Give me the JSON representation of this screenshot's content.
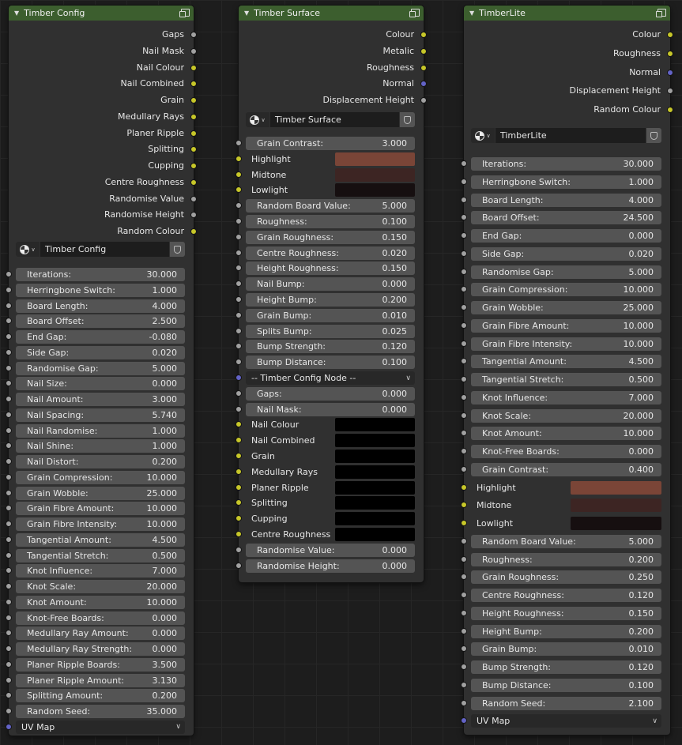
{
  "nodes": [
    {
      "id": "timber-config",
      "title": "Timber Config",
      "outputs": [
        {
          "label": "Gaps",
          "socket": "gray"
        },
        {
          "label": "Nail Mask",
          "socket": "gray"
        },
        {
          "label": "Nail Colour",
          "socket": "yellow"
        },
        {
          "label": "Nail Combined",
          "socket": "yellow"
        },
        {
          "label": "Grain",
          "socket": "yellow"
        },
        {
          "label": "Medullary Rays",
          "socket": "yellow"
        },
        {
          "label": "Planer Ripple",
          "socket": "yellow"
        },
        {
          "label": "Splitting",
          "socket": "yellow"
        },
        {
          "label": "Cupping",
          "socket": "yellow"
        },
        {
          "label": "Centre Roughness",
          "socket": "yellow"
        },
        {
          "label": "Randomise Value",
          "socket": "gray"
        },
        {
          "label": "Randomise Height",
          "socket": "gray"
        },
        {
          "label": "Random Colour",
          "socket": "yellow"
        }
      ],
      "group_name": "Timber Config",
      "inputs": [
        {
          "kind": "field",
          "label": "Iterations:",
          "value": "30.000"
        },
        {
          "kind": "field",
          "label": "Herringbone Switch:",
          "value": "1.000"
        },
        {
          "kind": "field",
          "label": "Board Length:",
          "value": "4.000"
        },
        {
          "kind": "field",
          "label": "Board Offset:",
          "value": "2.500"
        },
        {
          "kind": "field",
          "label": "End Gap:",
          "value": "-0.080"
        },
        {
          "kind": "field",
          "label": "Side Gap:",
          "value": "0.020"
        },
        {
          "kind": "field",
          "label": "Randomise Gap:",
          "value": "5.000"
        },
        {
          "kind": "field",
          "label": "Nail Size:",
          "value": "0.000"
        },
        {
          "kind": "field",
          "label": "Nail Amount:",
          "value": "3.000"
        },
        {
          "kind": "field",
          "label": "Nail Spacing:",
          "value": "5.740"
        },
        {
          "kind": "field",
          "label": "Nail Randomise:",
          "value": "1.000"
        },
        {
          "kind": "field",
          "label": "Nail Shine:",
          "value": "1.000"
        },
        {
          "kind": "field",
          "label": "Nail Distort:",
          "value": "0.200"
        },
        {
          "kind": "field",
          "label": "Grain Compression:",
          "value": "10.000"
        },
        {
          "kind": "field",
          "label": "Grain Wobble:",
          "value": "25.000"
        },
        {
          "kind": "field",
          "label": "Grain Fibre Amount:",
          "value": "10.000"
        },
        {
          "kind": "field",
          "label": "Grain Fibre Intensity:",
          "value": "10.000"
        },
        {
          "kind": "field",
          "label": "Tangential Amount:",
          "value": "4.500"
        },
        {
          "kind": "field",
          "label": "Tangential Stretch:",
          "value": "0.500"
        },
        {
          "kind": "field",
          "label": "Knot Influence:",
          "value": "7.000"
        },
        {
          "kind": "field",
          "label": "Knot Scale:",
          "value": "20.000"
        },
        {
          "kind": "field",
          "label": "Knot Amount:",
          "value": "10.000"
        },
        {
          "kind": "field",
          "label": "Knot-Free Boards:",
          "value": "0.000"
        },
        {
          "kind": "field",
          "label": "Medullary Ray Amount:",
          "value": "0.000"
        },
        {
          "kind": "field",
          "label": "Medullary Ray Strength:",
          "value": "0.000"
        },
        {
          "kind": "field",
          "label": "Planer Ripple Boards:",
          "value": "3.500"
        },
        {
          "kind": "field",
          "label": "Planer Ripple Amount:",
          "value": "3.130"
        },
        {
          "kind": "field",
          "label": "Splitting Amount:",
          "value": "0.200"
        },
        {
          "kind": "field",
          "label": "Random Seed:",
          "value": "35.000"
        },
        {
          "kind": "dropdown",
          "label": "UV Map",
          "socket": "blue"
        }
      ]
    },
    {
      "id": "timber-surface",
      "title": "Timber Surface",
      "outputs": [
        {
          "label": "Colour",
          "socket": "yellow"
        },
        {
          "label": "Metalic",
          "socket": "yellow"
        },
        {
          "label": "Roughness",
          "socket": "yellow"
        },
        {
          "label": "Normal",
          "socket": "blue"
        },
        {
          "label": "Displacement Height",
          "socket": "gray"
        }
      ],
      "group_name": "Timber Surface",
      "inputs": [
        {
          "kind": "field",
          "label": "Grain Contrast:",
          "value": "3.000"
        },
        {
          "kind": "color",
          "label": "Highlight",
          "color": "#7a4537"
        },
        {
          "kind": "color",
          "label": "Midtone",
          "color": "#3d2523"
        },
        {
          "kind": "color",
          "label": "Lowlight",
          "color": "#160f10"
        },
        {
          "kind": "field",
          "label": "Random Board Value:",
          "value": "5.000"
        },
        {
          "kind": "field",
          "label": "Roughness:",
          "value": "0.100"
        },
        {
          "kind": "field",
          "label": "Grain Roughness:",
          "value": "0.150"
        },
        {
          "kind": "field",
          "label": "Centre Roughness:",
          "value": "0.020"
        },
        {
          "kind": "field",
          "label": "Height Roughness:",
          "value": "0.150"
        },
        {
          "kind": "field",
          "label": "Nail Bump:",
          "value": "0.000"
        },
        {
          "kind": "field",
          "label": "Height Bump:",
          "value": "0.200"
        },
        {
          "kind": "field",
          "label": "Grain Bump:",
          "value": "0.010"
        },
        {
          "kind": "field",
          "label": "Splits Bump:",
          "value": "0.025"
        },
        {
          "kind": "field",
          "label": "Bump Strength:",
          "value": "0.120"
        },
        {
          "kind": "field",
          "label": "Bump Distance:",
          "value": "0.100"
        },
        {
          "kind": "dropdown",
          "label": "-- Timber Config Node --",
          "socket": "blue"
        },
        {
          "kind": "field",
          "label": "Gaps:",
          "value": "0.000"
        },
        {
          "kind": "field",
          "label": "Nail Mask:",
          "value": "0.000"
        },
        {
          "kind": "color",
          "label": "Nail Colour",
          "color": "#000000"
        },
        {
          "kind": "color",
          "label": "Nail Combined",
          "color": "#000000"
        },
        {
          "kind": "color",
          "label": "Grain",
          "color": "#000000"
        },
        {
          "kind": "color",
          "label": "Medullary Rays",
          "color": "#000000"
        },
        {
          "kind": "color",
          "label": "Planer Ripple",
          "color": "#000000"
        },
        {
          "kind": "color",
          "label": "Splitting",
          "color": "#000000"
        },
        {
          "kind": "color",
          "label": "Cupping",
          "color": "#000000"
        },
        {
          "kind": "color",
          "label": "Centre Roughness",
          "color": "#000000"
        },
        {
          "kind": "field",
          "label": "Randomise Value:",
          "value": "0.000"
        },
        {
          "kind": "field",
          "label": "Randomise Height:",
          "value": "0.000"
        }
      ]
    },
    {
      "id": "timberlite",
      "title": "TimberLite",
      "outputs": [
        {
          "label": "Colour",
          "socket": "yellow"
        },
        {
          "label": "Roughness",
          "socket": "yellow"
        },
        {
          "label": "Normal",
          "socket": "blue"
        },
        {
          "label": "Displacement Height",
          "socket": "gray"
        },
        {
          "label": "Random Colour",
          "socket": "yellow"
        }
      ],
      "group_name": "TimberLite",
      "inputs": [
        {
          "kind": "field",
          "label": "Iterations:",
          "value": "30.000"
        },
        {
          "kind": "field",
          "label": "Herringbone Switch:",
          "value": "1.000"
        },
        {
          "kind": "field",
          "label": "Board Length:",
          "value": "4.000"
        },
        {
          "kind": "field",
          "label": "Board Offset:",
          "value": "24.500"
        },
        {
          "kind": "field",
          "label": "End Gap:",
          "value": "0.000"
        },
        {
          "kind": "field",
          "label": "Side Gap:",
          "value": "0.020"
        },
        {
          "kind": "field",
          "label": "Randomise Gap:",
          "value": "5.000"
        },
        {
          "kind": "field",
          "label": "Grain Compression:",
          "value": "10.000"
        },
        {
          "kind": "field",
          "label": "Grain Wobble:",
          "value": "25.000"
        },
        {
          "kind": "field",
          "label": "Grain Fibre Amount:",
          "value": "10.000"
        },
        {
          "kind": "field",
          "label": "Grain Fibre Intensity:",
          "value": "10.000"
        },
        {
          "kind": "field",
          "label": "Tangential Amount:",
          "value": "4.500"
        },
        {
          "kind": "field",
          "label": "Tangential Stretch:",
          "value": "0.500"
        },
        {
          "kind": "field",
          "label": "Knot Influence:",
          "value": "7.000"
        },
        {
          "kind": "field",
          "label": "Knot Scale:",
          "value": "20.000"
        },
        {
          "kind": "field",
          "label": "Knot Amount:",
          "value": "10.000"
        },
        {
          "kind": "field",
          "label": "Knot-Free Boards:",
          "value": "0.000"
        },
        {
          "kind": "field",
          "label": "Grain Contrast:",
          "value": "0.400"
        },
        {
          "kind": "color",
          "label": "Highlight",
          "color": "#7a4537"
        },
        {
          "kind": "color",
          "label": "Midtone",
          "color": "#3d2523"
        },
        {
          "kind": "color",
          "label": "Lowlight",
          "color": "#160f10"
        },
        {
          "kind": "field",
          "label": "Random Board Value:",
          "value": "5.000"
        },
        {
          "kind": "field",
          "label": "Roughness:",
          "value": "0.200"
        },
        {
          "kind": "field",
          "label": "Grain Roughness:",
          "value": "0.250"
        },
        {
          "kind": "field",
          "label": "Centre Roughness:",
          "value": "0.120"
        },
        {
          "kind": "field",
          "label": "Height Roughness:",
          "value": "0.150"
        },
        {
          "kind": "field",
          "label": "Height Bump:",
          "value": "0.200"
        },
        {
          "kind": "field",
          "label": "Grain Bump:",
          "value": "0.010"
        },
        {
          "kind": "field",
          "label": "Bump Strength:",
          "value": "0.120"
        },
        {
          "kind": "field",
          "label": "Bump Distance:",
          "value": "0.100"
        },
        {
          "kind": "field",
          "label": "Random Seed:",
          "value": "2.100"
        },
        {
          "kind": "dropdown",
          "label": "UV Map",
          "socket": "blue"
        }
      ]
    }
  ]
}
